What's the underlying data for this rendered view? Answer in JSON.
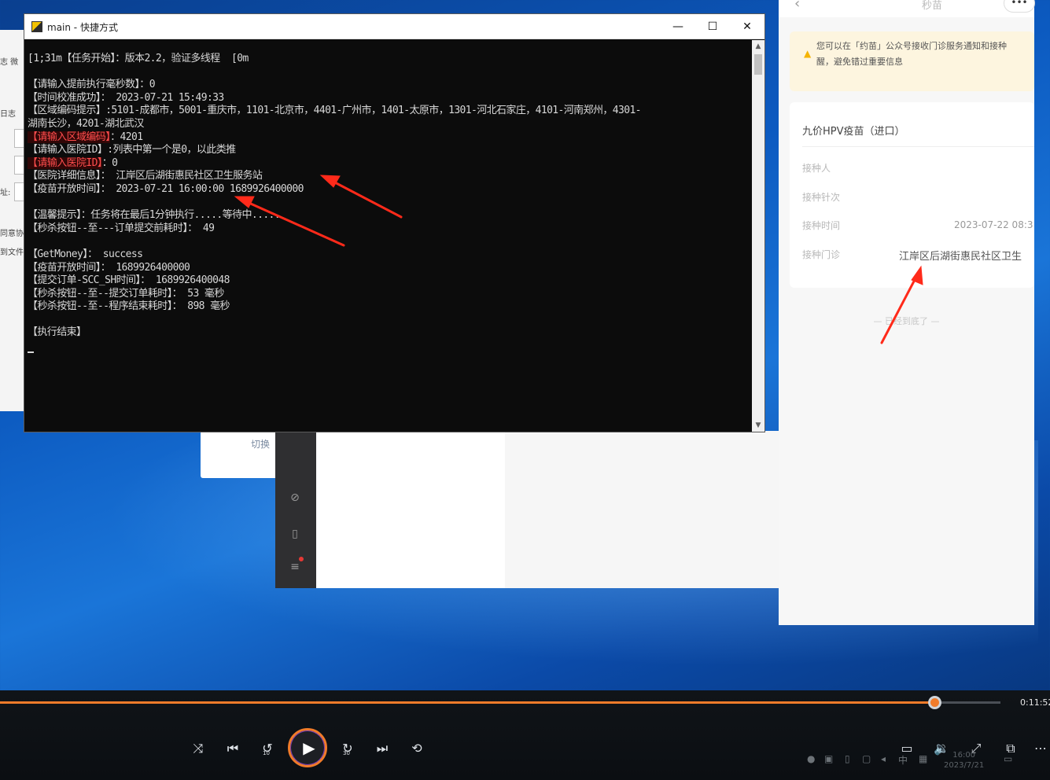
{
  "console": {
    "title": "main - 快捷方式",
    "controls": {
      "minimize": "—",
      "maximize": "☐",
      "close": "✕"
    },
    "lines": [
      {
        "text": "[1;31m【任务开始】：版本2.2，验证多线程  [0m"
      },
      {
        "text": ""
      },
      {
        "text": "【请输入提前执行毫秒数】：0"
      },
      {
        "text": "【时间校准成功】： 2023-07-21 15:49:33"
      },
      {
        "text": "【区域编码提示】:5101-成都市，5001-重庆市，1101-北京市，4401-广州市，1401-太原市，1301-河北石家庄，4101-河南郑州，4301-"
      },
      {
        "text": "湖南长沙，4201-湖北武汉"
      },
      {
        "hl": "【请输入区域编码】",
        "text": "：4201"
      },
      {
        "text": "【请输入医院ID】:列表中第一个是0，以此类推"
      },
      {
        "hl": "【请输入医院ID】",
        "text": "：0"
      },
      {
        "text": "【医院详细信息】： 江岸区后湖街惠民社区卫生服务站"
      },
      {
        "text": "【疫苗开放时间】： 2023-07-21 16:00:00 1689926400000"
      },
      {
        "text": ""
      },
      {
        "text": "【温馨提示】：任务将在最后1分钟执行.....等待中....."
      },
      {
        "text": "【秒杀按钮--至---订单提交前耗时】： 49"
      },
      {
        "text": ""
      },
      {
        "text": "【GetMoney】： success"
      },
      {
        "text": "【疫苗开放时间】： 1689926400000"
      },
      {
        "text": "【提交订单-SCC_SH时间】： 1689926400048"
      },
      {
        "text": "【秒杀按钮--至--提交订单耗时】： 53 毫秒"
      },
      {
        "text": "【秒杀按钮--至--程序结束耗时】： 898 毫秒"
      },
      {
        "text": ""
      },
      {
        "text": "【执行结束】"
      }
    ]
  },
  "bg_app": {
    "labels": [
      "志  微",
      "日志",
      "址:",
      "同意协",
      "到文件"
    ]
  },
  "bg_dialog": {
    "text": "切换"
  },
  "mini_program": {
    "nav_title": "秒苗",
    "back_icon": "‹",
    "more_label": "•••",
    "notice": "您可以在「约苗」公众号接收门诊服务通知和接种提醒，避免错过重要信息",
    "notice_line1": "您可以在「约苗」公众号接收门诊服务通知和接种",
    "notice_line2": "醒，避免错过重要信息",
    "card": {
      "title": "九价HPV疫苗（进口）",
      "fields": [
        {
          "label": "接种人",
          "value": ""
        },
        {
          "label": "接种针次",
          "value": ""
        },
        {
          "label": "接种时间",
          "value": "2023-07-22  08:3"
        },
        {
          "label": "接种门诊",
          "value": "江岸区后湖街惠民社区卫生"
        }
      ]
    },
    "end_text": "— 已经到底了 —"
  },
  "player": {
    "current_time": "0:11:52",
    "progress": 0.935,
    "controls": [
      "shuffle",
      "previous",
      "rewind-10",
      "play",
      "forward-30",
      "next",
      "repeat-off"
    ],
    "rewind_label": "10",
    "forward_label": "30",
    "right_controls": [
      "subtitles",
      "volume",
      "fullscreen",
      "picture-in-picture",
      "more"
    ]
  },
  "taskbar": {
    "time": "16:00",
    "date": "2023/7/21",
    "ime": "中"
  },
  "colors": {
    "accent": "#f07b2a",
    "console_bg": "#0c0c0c",
    "console_highlight": "#ff4d4d",
    "arrow": "#ff2a1a"
  }
}
